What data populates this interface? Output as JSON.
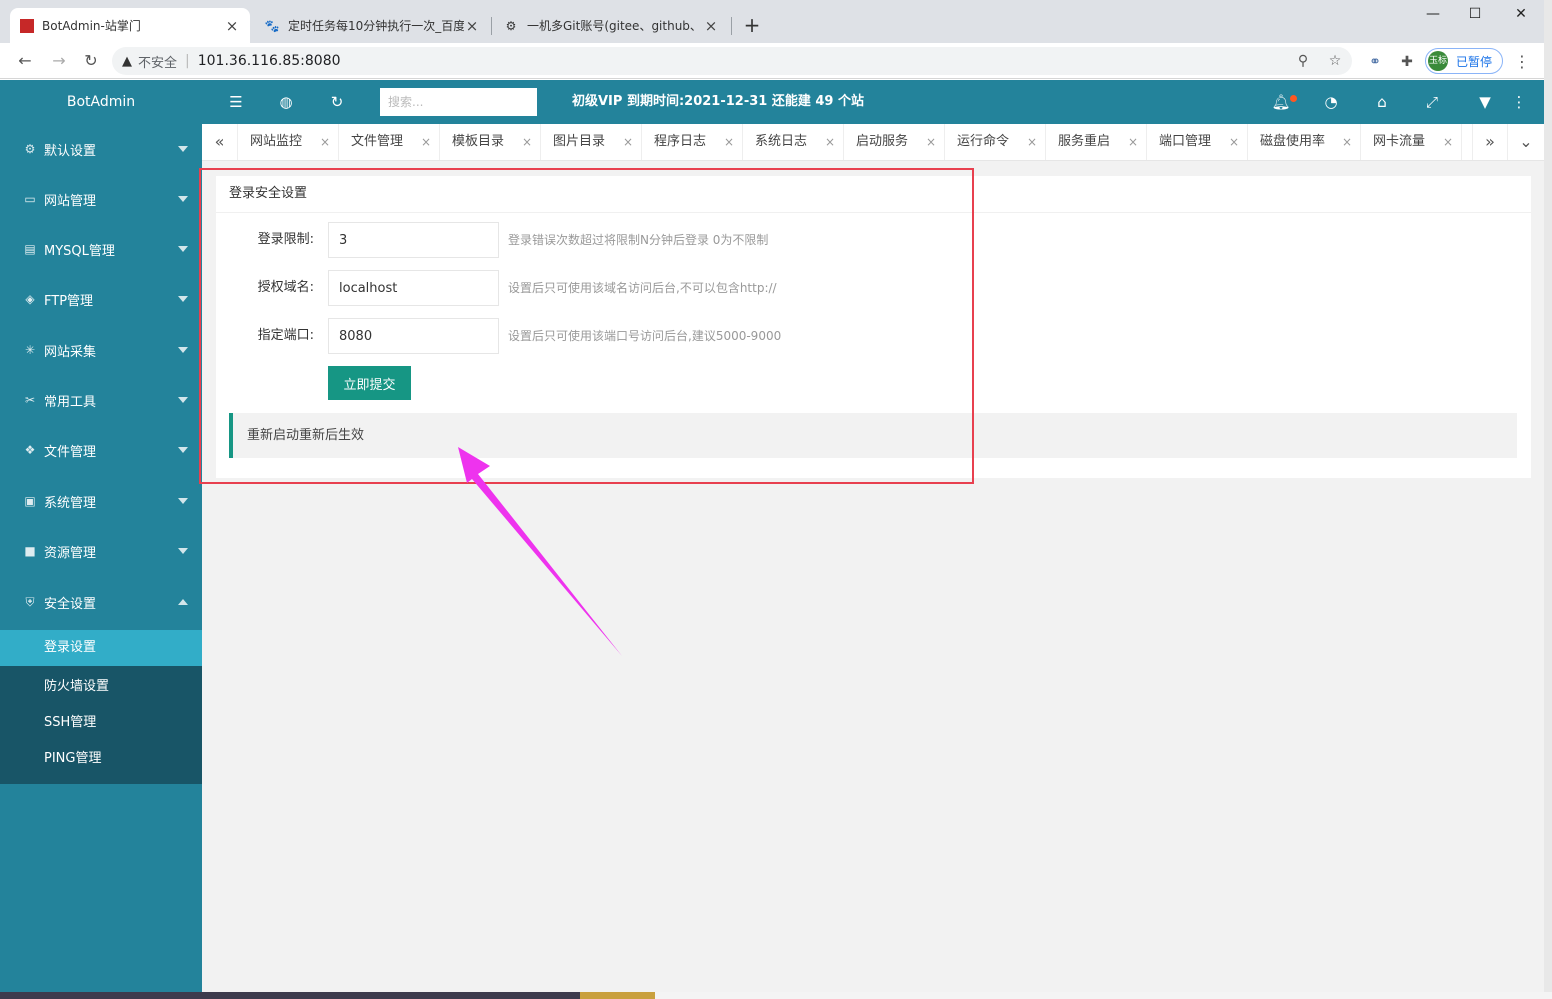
{
  "browser": {
    "tabs": [
      {
        "title": "BotAdmin-站掌门",
        "icon": "botadmin-favicon"
      },
      {
        "title": "定时任务每10分钟执行一次_百度",
        "icon": "baidu-paw-favicon"
      },
      {
        "title": "一机多Git账号(gitee、github、",
        "icon": "git-favicon"
      }
    ],
    "insecure_label": "不安全",
    "url": "101.36.116.85:8080",
    "profile_avatar": "玉标",
    "profile_label": "已暂停"
  },
  "app": {
    "logo": "BotAdmin",
    "search_placeholder": "搜索...",
    "vip_text": "初级VIP 到期时间:2021-12-31 还能建 49 个站",
    "sidebar": [
      {
        "label": "默认设置",
        "icon": "gear-icon"
      },
      {
        "label": "网站管理",
        "icon": "monitor-icon"
      },
      {
        "label": "MYSQL管理",
        "icon": "database-icon"
      },
      {
        "label": "FTP管理",
        "icon": "ftp-icon"
      },
      {
        "label": "网站采集",
        "icon": "spider-icon"
      },
      {
        "label": "常用工具",
        "icon": "tools-icon"
      },
      {
        "label": "文件管理",
        "icon": "file-icon"
      },
      {
        "label": "系统管理",
        "icon": "system-icon"
      },
      {
        "label": "资源管理",
        "icon": "resource-icon"
      },
      {
        "label": "安全设置",
        "icon": "shield-icon"
      }
    ],
    "submenu": [
      "登录设置",
      "防火墙设置",
      "SSH管理",
      "PING管理"
    ],
    "page_tabs": [
      "网站监控",
      "文件管理",
      "模板目录",
      "图片目录",
      "程序日志",
      "系统日志",
      "启动服务",
      "运行命令",
      "服务重启",
      "端口管理",
      "磁盘使用率",
      "网卡流量"
    ],
    "tab_close": "×"
  },
  "form": {
    "title": "登录安全设置",
    "fields": [
      {
        "label": "登录限制:",
        "value": "3",
        "hint": "登录错误次数超过将限制N分钟后登录 0为不限制"
      },
      {
        "label": "授权域名:",
        "value": "localhost",
        "hint": "设置后只可使用该域名访问后台,不可以包含http://"
      },
      {
        "label": "指定端口:",
        "value": "8080",
        "hint": "设置后只可使用该端口号访问后台,建议5000-9000"
      }
    ],
    "submit": "立即提交",
    "notice": "重新启动重新后生效"
  },
  "colors": {
    "sidebar": "#23839b",
    "accent": "#169684",
    "highlight_box": "#e8404f",
    "arrow": "#ee33ee"
  }
}
